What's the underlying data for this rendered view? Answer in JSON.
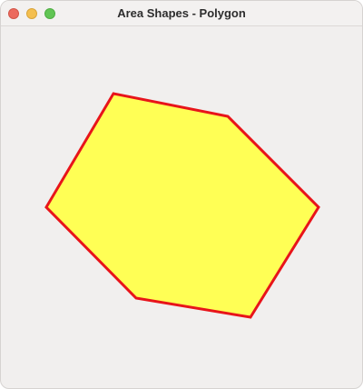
{
  "window": {
    "title": "Area Shapes - Polygon"
  },
  "shape": {
    "type": "polygon",
    "fill_color": "#ffff55",
    "stroke_color": "#e8141a"
  }
}
